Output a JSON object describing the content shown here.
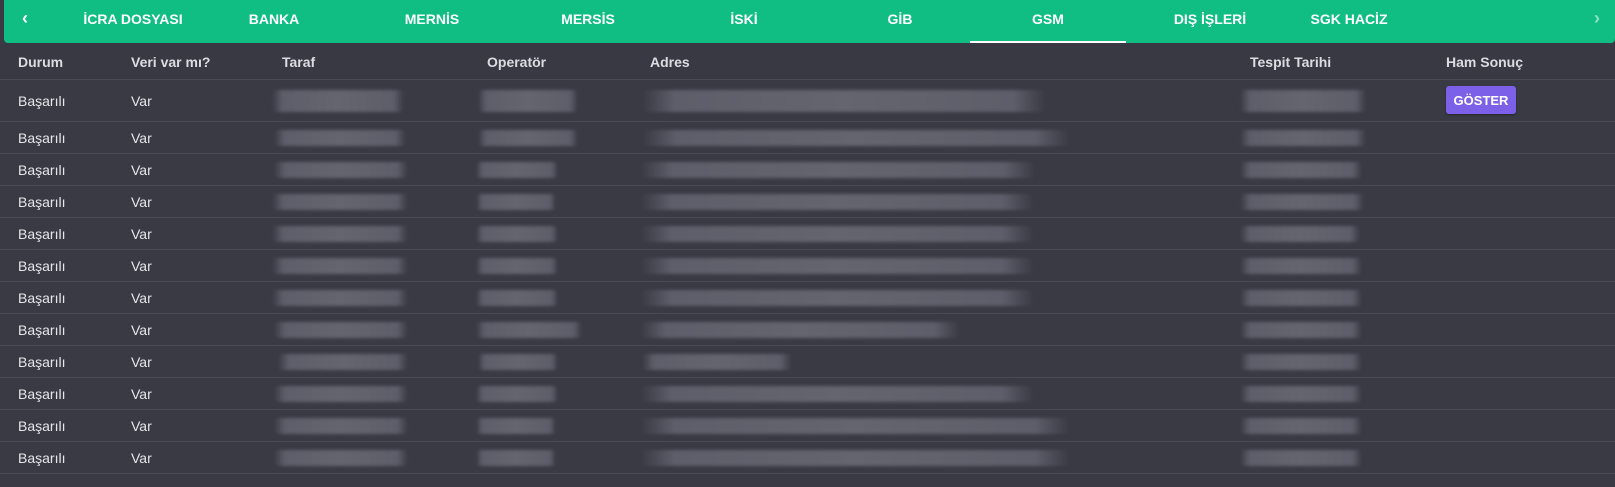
{
  "tabs": [
    {
      "label": "İCRA DOSYASI",
      "active": false
    },
    {
      "label": "BANKA",
      "active": false
    },
    {
      "label": "MERNİS",
      "active": false
    },
    {
      "label": "MERSİS",
      "active": false
    },
    {
      "label": "İSKİ",
      "active": false
    },
    {
      "label": "GİB",
      "active": false
    },
    {
      "label": "GSM",
      "active": true
    },
    {
      "label": "DIŞ İŞLERİ",
      "active": false
    },
    {
      "label": "SGK HACİZ",
      "active": false
    }
  ],
  "colors": {
    "tabbar_bg": "#10bd83",
    "page_bg": "#3a3a44",
    "button_bg": "#7c61e8"
  },
  "table": {
    "columns": [
      "Durum",
      "Veri var mı?",
      "Taraf",
      "Operatör",
      "Adres",
      "Tespit Tarihi",
      "Ham Sonuç"
    ],
    "rows": [
      {
        "durum": "Başarılı",
        "veri": "Var",
        "action": "GÖSTER"
      },
      {
        "durum": "Başarılı",
        "veri": "Var"
      },
      {
        "durum": "Başarılı",
        "veri": "Var"
      },
      {
        "durum": "Başarılı",
        "veri": "Var"
      },
      {
        "durum": "Başarılı",
        "veri": "Var"
      },
      {
        "durum": "Başarılı",
        "veri": "Var"
      },
      {
        "durum": "Başarılı",
        "veri": "Var"
      },
      {
        "durum": "Başarılı",
        "veri": "Var"
      },
      {
        "durum": "Başarılı",
        "veri": "Var"
      },
      {
        "durum": "Başarılı",
        "veri": "Var"
      },
      {
        "durum": "Başarılı",
        "veri": "Var"
      },
      {
        "durum": "Başarılı",
        "veri": "Var"
      }
    ]
  },
  "icons": {
    "prev": "chevron-left-icon",
    "next": "chevron-right-icon"
  }
}
